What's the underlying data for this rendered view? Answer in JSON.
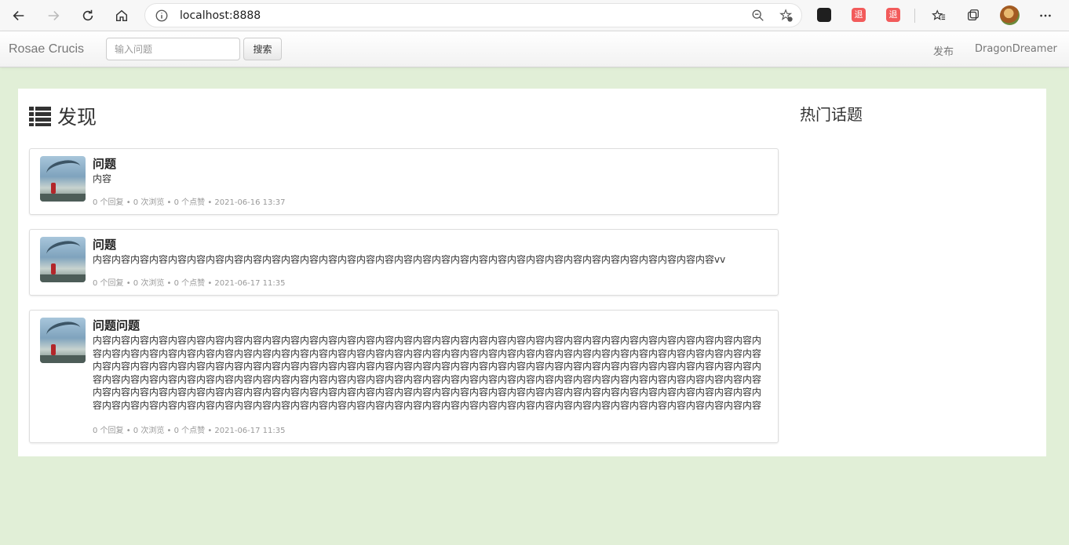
{
  "browser": {
    "url": "localhost:8888",
    "ext_labels": [
      "退",
      "退"
    ]
  },
  "navbar": {
    "brand": "Rosae Crucis",
    "search_placeholder": "输入问题",
    "search_button": "搜索",
    "publish_link": "发布",
    "user_link": "DragonDreamer"
  },
  "main": {
    "title": "发现",
    "side_title": "热门话题",
    "questions": [
      {
        "title": "问题",
        "body": "内容",
        "meta": "0 个回复 • 0 次浏览 • 0 个点赞 • 2021-06-16 13:37"
      },
      {
        "title": "问题",
        "body": "内容内容内容内容内容内容内容内容内容内容内容内容内容内容内容内容内容内容内容内容内容内容内容内容内容内容内容内容内容内容内容内容内容vv",
        "meta": "0 个回复 • 0 次浏览 • 0 个点赞 • 2021-06-17 11:35"
      },
      {
        "title": "问题问题",
        "body": "内容内容内容内容内容内容内容内容内容内容内容内容内容内容内容内容内容内容内容内容内容内容内容内容内容内容内容内容内容内容内容内容内容内容内容内容内容内容内容内容内容内容内容内容内容内容内容内容内容内容内容内容内容内容内容内容内容内容内容内容内容内容内容内容内容内容内容内容内容内容内容内容内容内容内容内容内容内容内容内容内容内容内容内容内容内容内容内容内容内容内容内容内容内容内容内容内容内容内容内容内容内容内容内容内容内容内容内容内容内容内容内容内容内容内容内容内容内容内容内容内容内容内容内容内容内容内容内容内容内容内容内容内容内容内容内容内容内容内容内容内容内容内容内容内容内容内容内容内容内容内容内容内容内容内容内容内容内容内容内容内容内容内容内容内容内容内容内容内容内容内容内容内容内容内容内容内容内容内容内容内容内容内容内容内容内容内容内容内容内容内容内容内容内容内容内容内容内容内容内容内容内容内容内容内容内容内容内容内容内容内容内容内容内容内容内容内容内容内容内容内容内容内容内容内容内容内容内容内容内容内容内容内容内容内容内容内容内容内容内容内容内容内容内容内容内容内容内容内容内容内容内容内容内容内容内容内容内容内容内容内容内容内容内容内容内容内容内容",
        "meta": "0 个回复 • 0 次浏览 • 0 个点赞 • 2021-06-17 11:35"
      }
    ]
  }
}
